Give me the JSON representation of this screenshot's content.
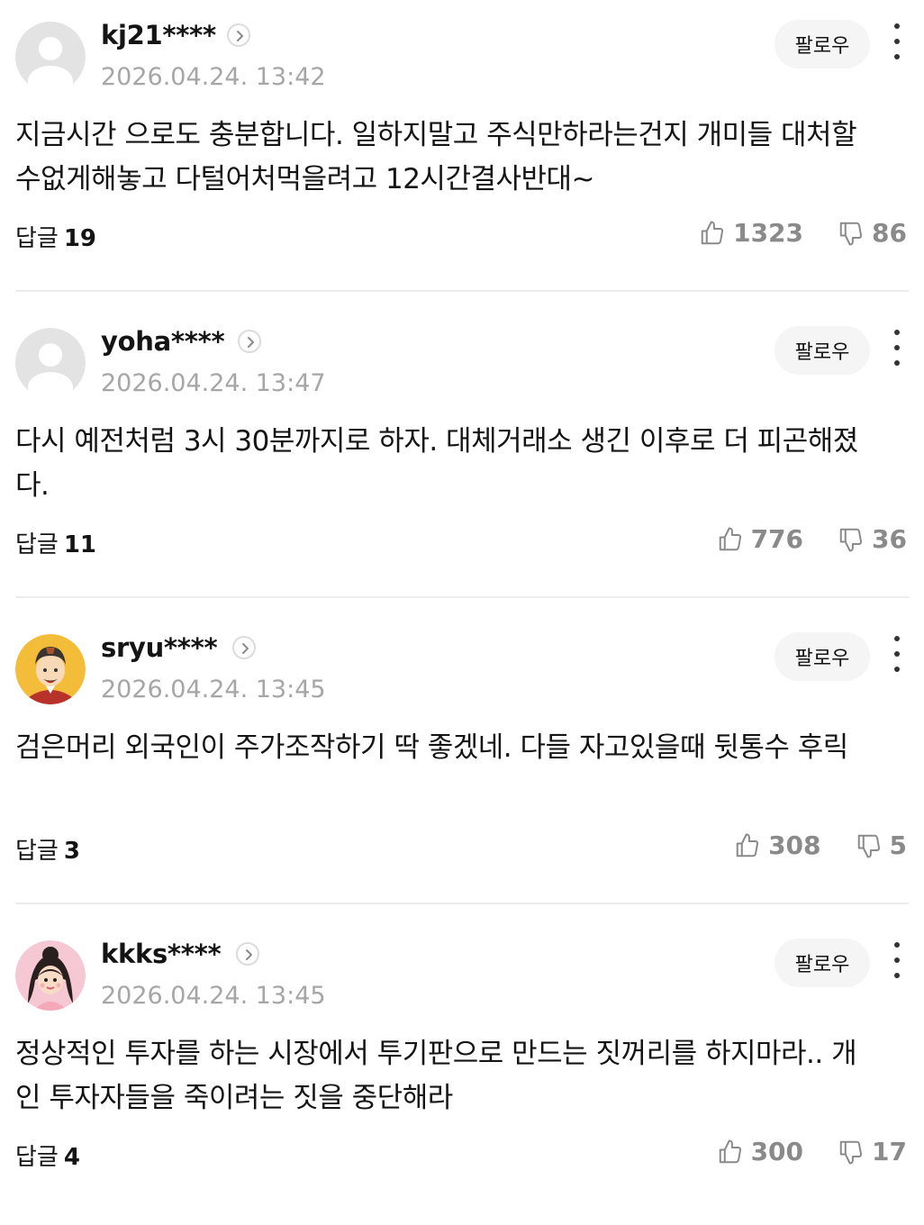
{
  "follow_label": "팔로우",
  "reply_label": "답글",
  "comments": [
    {
      "username": "kj21****",
      "timestamp": "2026.04.24. 13:42",
      "body": "지금시간 으로도 충분합니다. 일하지말고 주식만하라는건지 개미들 대처할수없게해놓고 다털어처먹을려고 12시간결사반대~",
      "replies": "19",
      "likes": "1323",
      "dislikes": "86",
      "avatar": "default-avatar-icon"
    },
    {
      "username": "yoha****",
      "timestamp": "2026.04.24. 13:47",
      "body": "다시 예전처럼 3시 30분까지로 하자. 대체거래소 생긴 이후로 더 피곤해졌다.",
      "replies": "11",
      "likes": "776",
      "dislikes": "36",
      "avatar": "default-avatar-icon"
    },
    {
      "username": "sryu****",
      "timestamp": "2026.04.24. 13:45",
      "body": "검은머리 외국인이 주가조작하기 딱 좋겠네. 다들 자고있을때 뒷통수 후릭",
      "replies": "3",
      "likes": "308",
      "dislikes": "5",
      "avatar": "cartoon-man-avatar"
    },
    {
      "username": "kkks****",
      "timestamp": "2026.04.24. 13:45",
      "body": "정상적인 투자를 하는 시장에서 투기판으로 만드는 짓꺼리를 하지마라.. 개인 투자자들을 죽이려는 짓을 중단해라",
      "replies": "4",
      "likes": "300",
      "dislikes": "17",
      "avatar": "cartoon-woman-avatar"
    }
  ]
}
